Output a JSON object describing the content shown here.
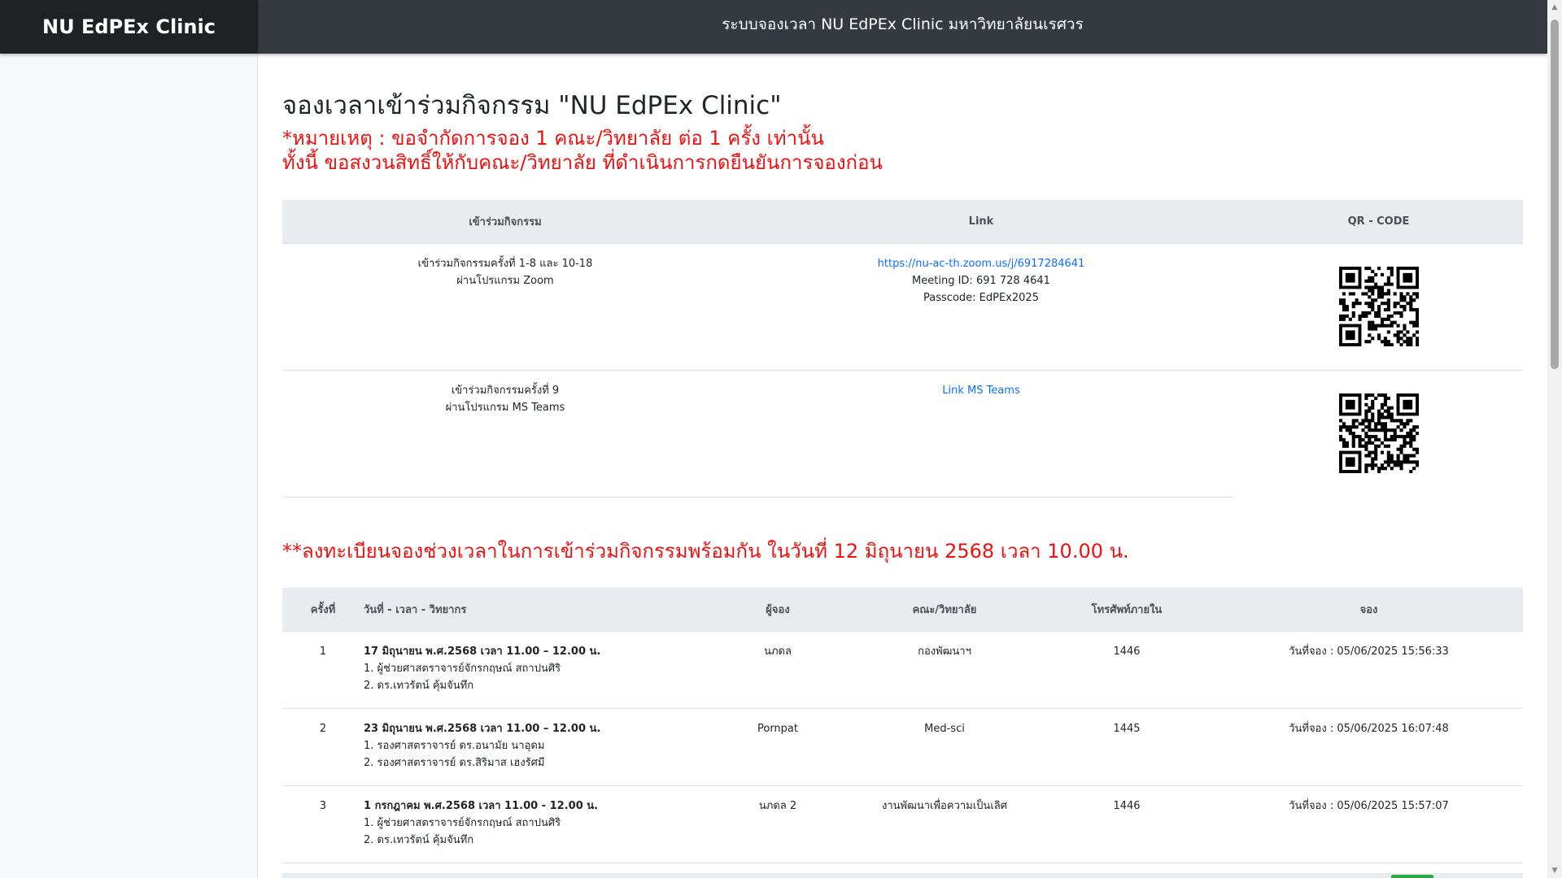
{
  "header": {
    "brand": "NU EdPEx Clinic",
    "title": "ระบบจองเวลา NU EdPEx Clinic มหาวิทยาลัยนเรศวร"
  },
  "page": {
    "title": "จองเวลาเข้าร่วมกิจกรรม \"NU EdPEx Clinic\"",
    "note_line1": "*หมายเหตุ : ขอจำกัดการจอง 1 คณะ/วิทยาลัย ต่อ 1 ครั้ง เท่านั้น",
    "note_line2": "ทั้งนี้ ขอสงวนสิทธิ์ให้กับคณะ/วิทยาลัย ที่ดำเนินการกดยืนยันการจองก่อน",
    "registration_note": "**ลงทะเบียนจองช่วงเวลาในการเข้าร่วมกิจกรรมพร้อมกัน ในวันที่ 12 มิถุนายน 2568 เวลา 10.00 น."
  },
  "join_table": {
    "headers": [
      "เข้าร่วมกิจกรรม",
      "Link",
      "QR - CODE"
    ],
    "rows": [
      {
        "activity_line1": "เข้าร่วมกิจกรรมครั้งที่ 1-8 และ 10-18",
        "activity_line2": "ผ่านโปรแกรม Zoom",
        "link_text": "https://nu-ac-th.zoom.us/j/6917284641",
        "meeting_id": "Meeting ID: 691 728 4641",
        "passcode": "Passcode: EdPEx2025"
      },
      {
        "activity_line1": "เข้าร่วมกิจกรรมครั้งที่ 9",
        "activity_line2": "ผ่านโปรแกรม MS Teams",
        "link_text": "Link MS Teams"
      }
    ]
  },
  "booking_table": {
    "headers": [
      "ครั้งที่",
      "วันที่ - เวลา - วิทยากร",
      "ผู้จอง",
      "คณะ/วิทยาลัย",
      "โทรศัพท์ภายใน",
      "จอง"
    ],
    "rows": [
      {
        "no": "1",
        "date": "17 มิถุนายน พ.ศ.2568 เวลา 11.00 – 12.00 น.",
        "speaker1": "1. ผู้ช่วยศาสตราจารย์จักรกฤษณ์ สถาปนศิริ",
        "speaker2": "2. ดร.เทวรัตน์ คุ้มจันทึก",
        "booker": "นภดล",
        "faculty": "กองพัฒนาฯ",
        "phone": "1446",
        "booked": "วันที่จอง : 05/06/2025 15:56:33"
      },
      {
        "no": "2",
        "date": "23 มิถุนายน พ.ศ.2568 เวลา 11.00 – 12.00 น.",
        "speaker1": "1. รองศาสตราจารย์ ดร.อนามัย นาอุดม",
        "speaker2": "2. รองศาสตราจารย์ ดร.สิริมาส เฮงรัศมี",
        "booker": "Pornpat",
        "faculty": "Med-sci",
        "phone": "1445",
        "booked": "วันที่จอง : 05/06/2025 16:07:48"
      },
      {
        "no": "3",
        "date": "1 กรกฎาคม พ.ศ.2568 เวลา 11.00 - 12.00 น.",
        "speaker1": "1. ผู้ช่วยศาสตราจารย์จักรกฤษณ์ สถาปนศิริ",
        "speaker2": "2. ดร.เทวรัตน์ คุ้มจันทึก",
        "booker": "นภดล 2",
        "faculty": "งานพัฒนาเพื่อความเป็นเลิศ",
        "phone": "1446",
        "booked": "วันที่จอง : 05/06/2025 15:57:07"
      }
    ]
  },
  "colors": {
    "brand_bg": "#1f2125",
    "topbar_bg": "#353a40",
    "note_red": "#ee1111",
    "link_blue": "#0d6efd",
    "header_gray": "#e9ecef"
  }
}
